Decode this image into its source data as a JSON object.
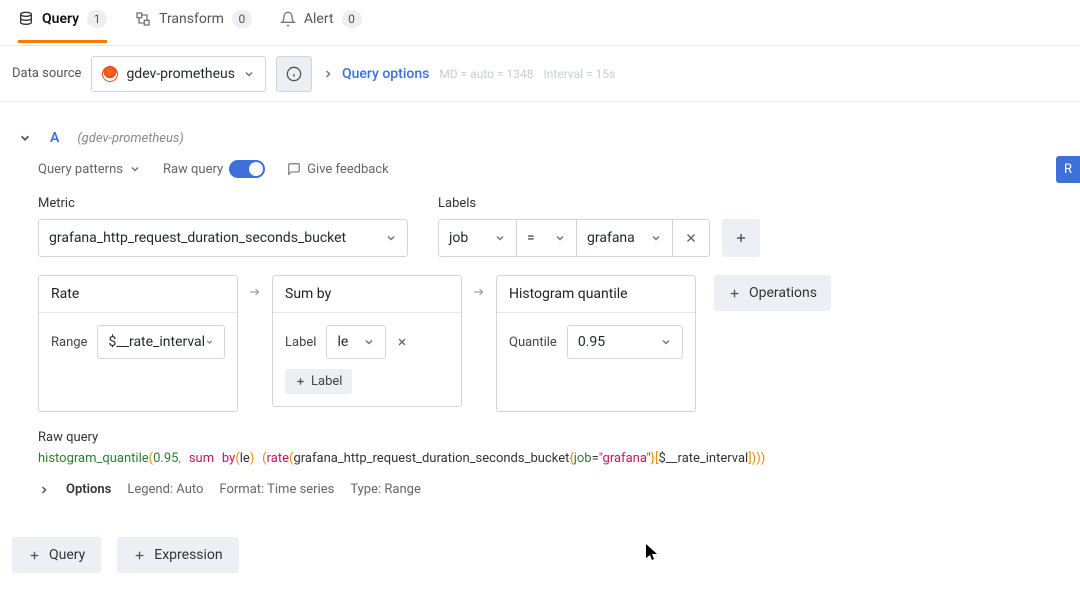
{
  "tabs": {
    "query": {
      "label": "Query",
      "count": "1"
    },
    "transform": {
      "label": "Transform",
      "count": "0"
    },
    "alert": {
      "label": "Alert",
      "count": "0"
    }
  },
  "datasource": {
    "label": "Data source",
    "selected": "gdev-prometheus",
    "query_options_label": "Query options",
    "hint_md": "MD = auto = 1348",
    "hint_interval": "Interval = 15s"
  },
  "query": {
    "letter": "A",
    "source": "(gdev-prometheus)",
    "patterns_label": "Query patterns",
    "raw_toggle_label": "Raw query",
    "feedback_label": "Give feedback",
    "run_label": "R"
  },
  "metric": {
    "title": "Metric",
    "value": "grafana_http_request_duration_seconds_bucket"
  },
  "labels": {
    "title": "Labels",
    "key": "job",
    "op": "=",
    "val": "grafana"
  },
  "ops": {
    "rate": {
      "title": "Rate",
      "range_label": "Range",
      "range_value": "$__rate_interval"
    },
    "sumby": {
      "title": "Sum by",
      "label_label": "Label",
      "label_value": "le",
      "add_label": "Label"
    },
    "hist": {
      "title": "Histogram quantile",
      "q_label": "Quantile",
      "q_value": "0.95"
    },
    "add_btn": "Operations"
  },
  "raw": {
    "title": "Raw query",
    "fn": "histogram_quantile",
    "q": "0.95",
    "sum": "sum",
    "by": "by",
    "byarg": "le",
    "rate": "rate",
    "metric": "grafana_http_request_duration_seconds_bucket",
    "lbl": "job",
    "lval": "\"grafana\"",
    "range": "$__rate_interval"
  },
  "options_row": {
    "options": "Options",
    "legend": "Legend: Auto",
    "format": "Format: Time series",
    "type": "Type: Range"
  },
  "bottom": {
    "query": "Query",
    "expression": "Expression"
  }
}
